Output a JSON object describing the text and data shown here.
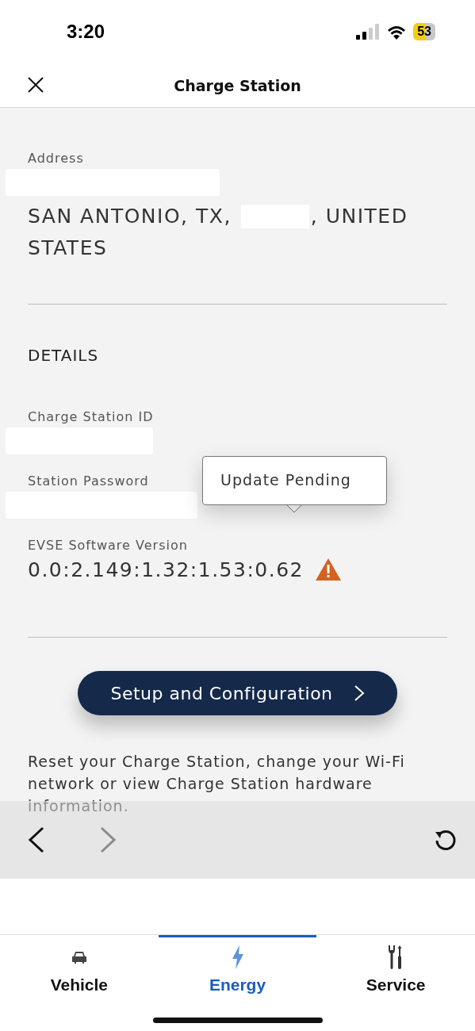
{
  "status_bar": {
    "time": "3:20",
    "battery": "53"
  },
  "header": {
    "title": "Charge Station"
  },
  "address": {
    "label": "Address",
    "before": "SAN ANTONIO, TX,",
    "after": ", UNITED",
    "line2": "STATES"
  },
  "details": {
    "heading": "DETAILS",
    "fields": [
      {
        "label": "Charge Station ID",
        "kind": "redacted"
      },
      {
        "label": "Station Password",
        "kind": "redacted"
      },
      {
        "label": "EVSE Software Version",
        "kind": "version",
        "value": "0.0:2.149:1.32:1.53:0.62",
        "tooltip": "Update Pending",
        "warning": true
      }
    ]
  },
  "setup_button": {
    "label": "Setup and Configuration"
  },
  "description": "Reset your Charge Station, change your Wi-Fi network or view Charge Station hardware information.",
  "browser_toolbar": {
    "back_disabled": false,
    "forward_disabled": true
  },
  "tabs": [
    {
      "label": "Vehicle",
      "kind": "car",
      "selected": false
    },
    {
      "label": "Energy",
      "kind": "bolt",
      "selected": true
    },
    {
      "label": "Service",
      "kind": "tools",
      "selected": false
    }
  ]
}
